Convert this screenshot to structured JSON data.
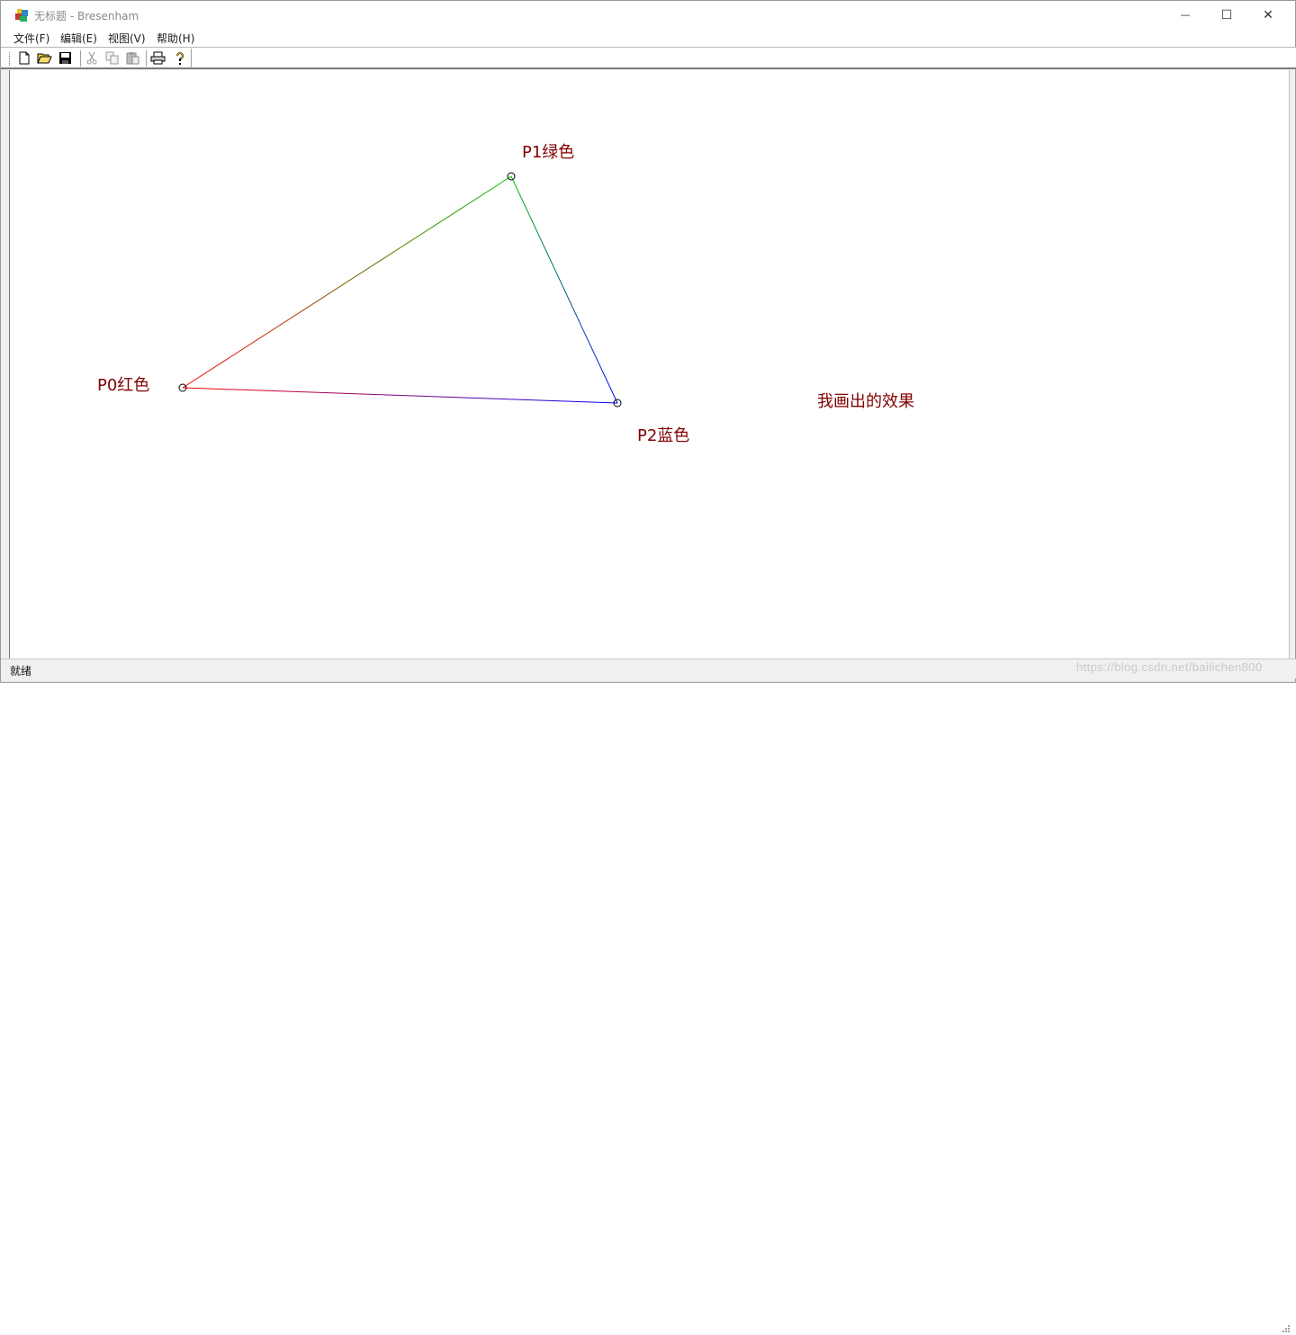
{
  "window": {
    "title": "无标题 - Bresenham",
    "controls": {
      "minimize": "—",
      "maximize": "☐",
      "close": "✕"
    }
  },
  "menubar": {
    "items": [
      {
        "label": "文件(F)"
      },
      {
        "label": "编辑(E)"
      },
      {
        "label": "视图(V)"
      },
      {
        "label": "帮助(H)"
      }
    ]
  },
  "toolbar": {
    "buttons": [
      "new-icon",
      "open-icon",
      "save-icon",
      "cut-icon",
      "copy-icon",
      "paste-icon",
      "print-icon",
      "help-icon"
    ],
    "disabled": [
      "cut-icon",
      "copy-icon",
      "paste-icon"
    ]
  },
  "canvas": {
    "labels": {
      "p0": "P0红色",
      "p1": "P1绿色",
      "p2": "P2蓝色",
      "caption": "我画出的效果"
    },
    "colors": {
      "p0": "#ff0000",
      "p1": "#00c000",
      "p2": "#0000ff",
      "label": "#800000"
    }
  },
  "statusbar": {
    "text": "就绪"
  },
  "watermark": "https://blog.csdn.net/bailichen800"
}
